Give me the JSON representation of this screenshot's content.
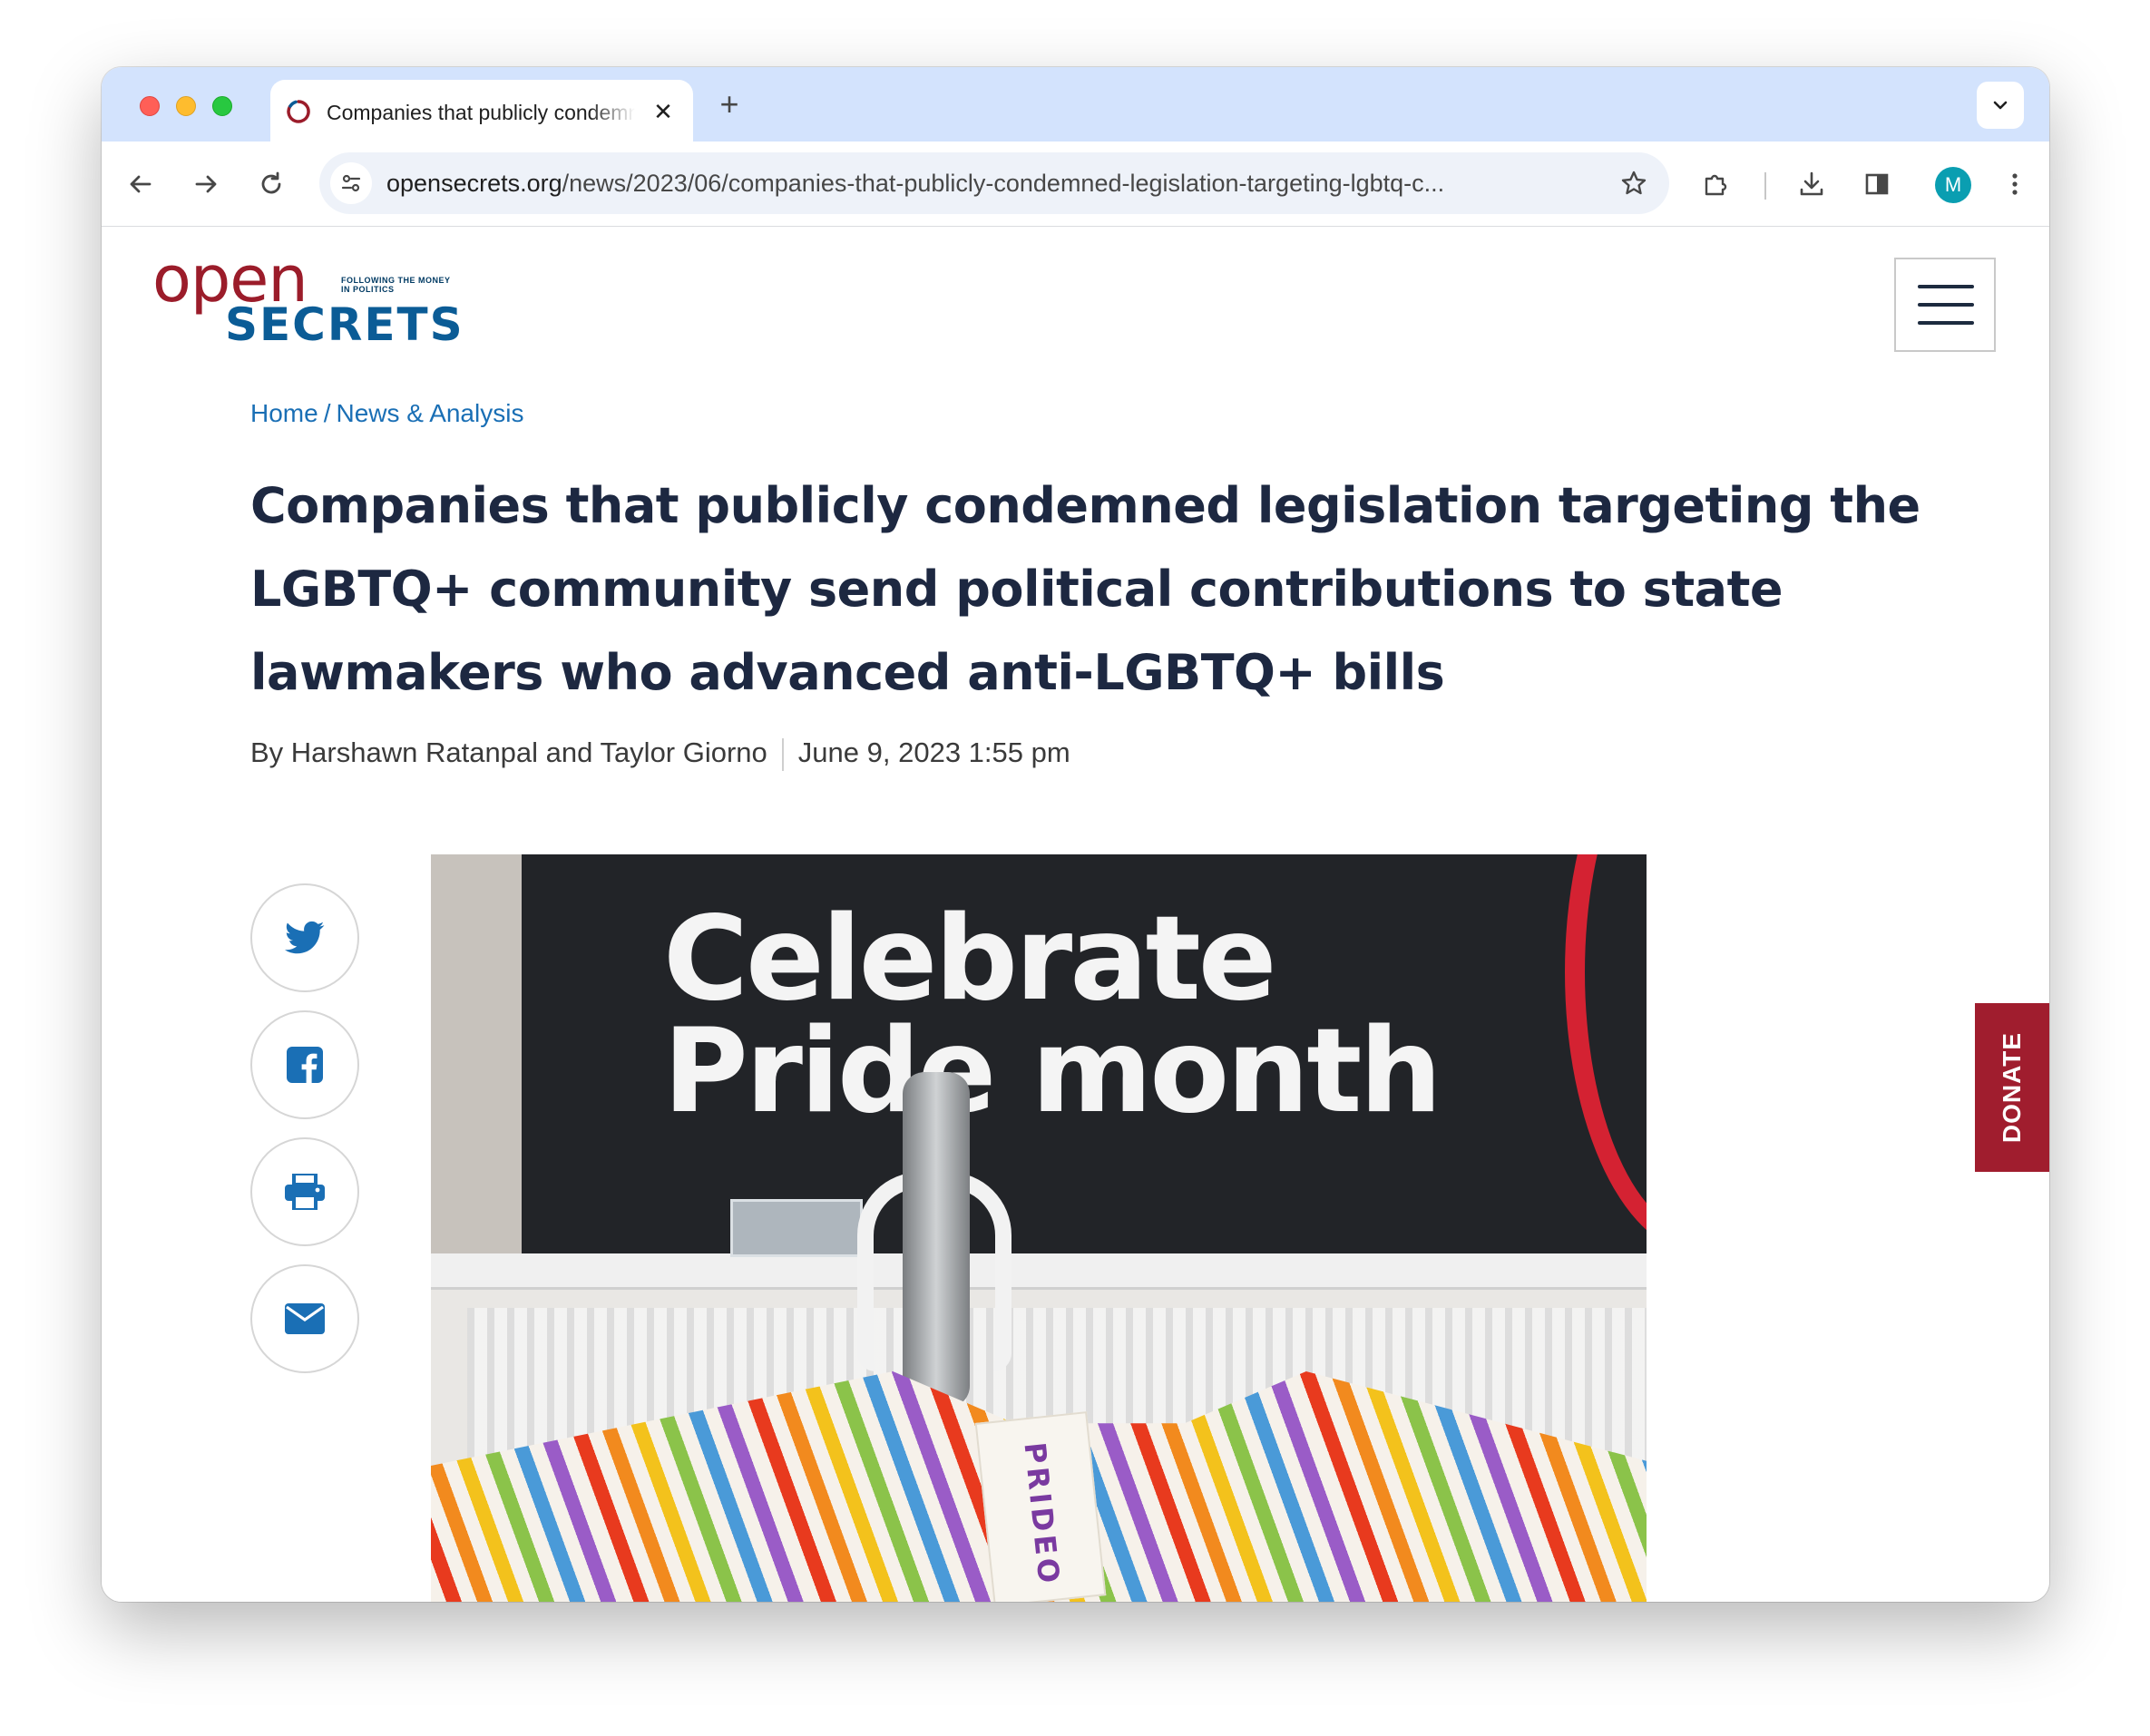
{
  "browser": {
    "tab_title": "Companies that publicly condemned legislation targeting the LGBTQ+ community",
    "tab_close": "✕",
    "new_tab": "+",
    "url_host": "opensecrets.org",
    "url_path": "/news/2023/06/companies-that-publicly-condemned-legislation-targeting-lgbtq-c...",
    "profile_initial": "M"
  },
  "site": {
    "logo_open": "open",
    "logo_tagline": "FOLLOWING THE MONEY IN POLITICS",
    "logo_secrets": "SECRETS",
    "donate_label": "DONATE"
  },
  "article": {
    "breadcrumb": [
      "Home",
      "News & Analysis"
    ],
    "breadcrumb_sep": "/",
    "headline": "Companies that publicly condemned legislation targeting the LGBTQ+ community send political contributions to state lawmakers who advanced anti-LGBTQ+ bills",
    "byline": "By Harshawn Ratanpal and Taylor Giorno",
    "date": "June 9, 2023 1:55 pm"
  },
  "hero_image": {
    "sign_line1": "Celebrate",
    "sign_line2": "Pride month",
    "tag_text": "PRIDEO"
  },
  "share_buttons": [
    "twitter-icon",
    "facebook-icon",
    "print-icon",
    "email-icon"
  ],
  "colors": {
    "accent_blue": "#1a6fb5",
    "logo_red": "#9b1c2a",
    "logo_blue": "#0b5c96",
    "headline": "#1d2841",
    "donate": "#a01d2e"
  }
}
